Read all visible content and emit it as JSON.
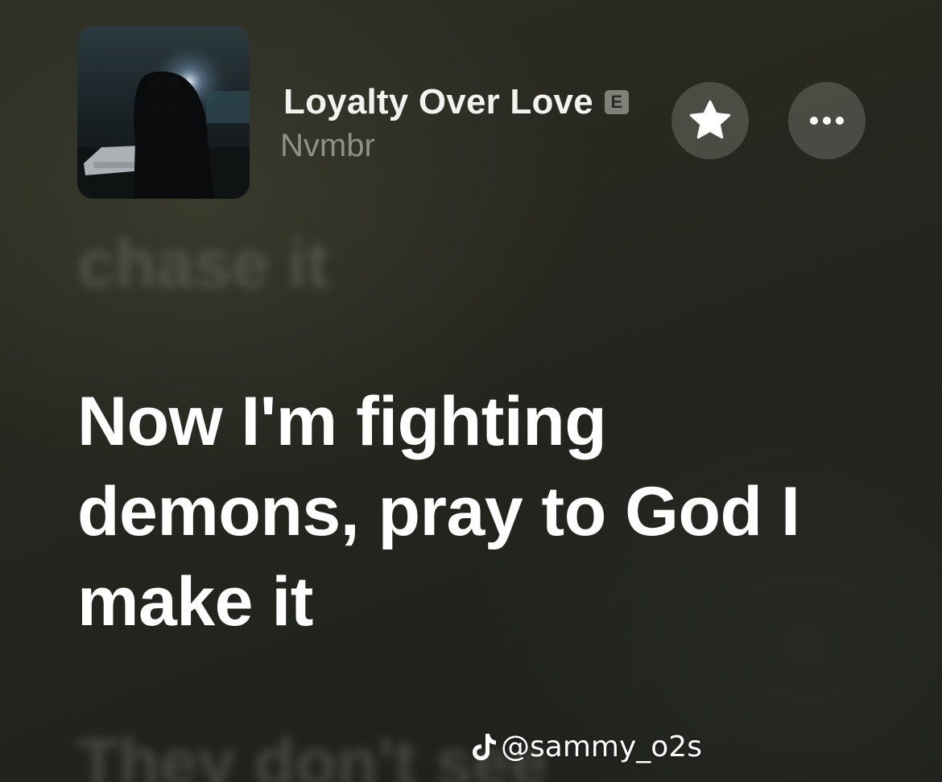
{
  "now_playing": {
    "title": "Loyalty Over Love",
    "explicit_badge": "E",
    "artist": "Nvmbr",
    "artwork_icon": "album-artwork"
  },
  "actions": {
    "favorite_icon": "star-icon",
    "more_icon": "ellipsis-icon"
  },
  "lyrics": {
    "previous_line": "chase it",
    "current_line": "Now I'm fighting demons, pray to God I make it",
    "next_line": "They don't see"
  },
  "watermark": {
    "icon": "tiktok-icon",
    "handle": "@sammy_o2s"
  },
  "colors": {
    "background": "#25261f",
    "lyric_active": "#ffffff",
    "lyric_inactive": "#8c8c80",
    "button_fill": "#787870"
  }
}
